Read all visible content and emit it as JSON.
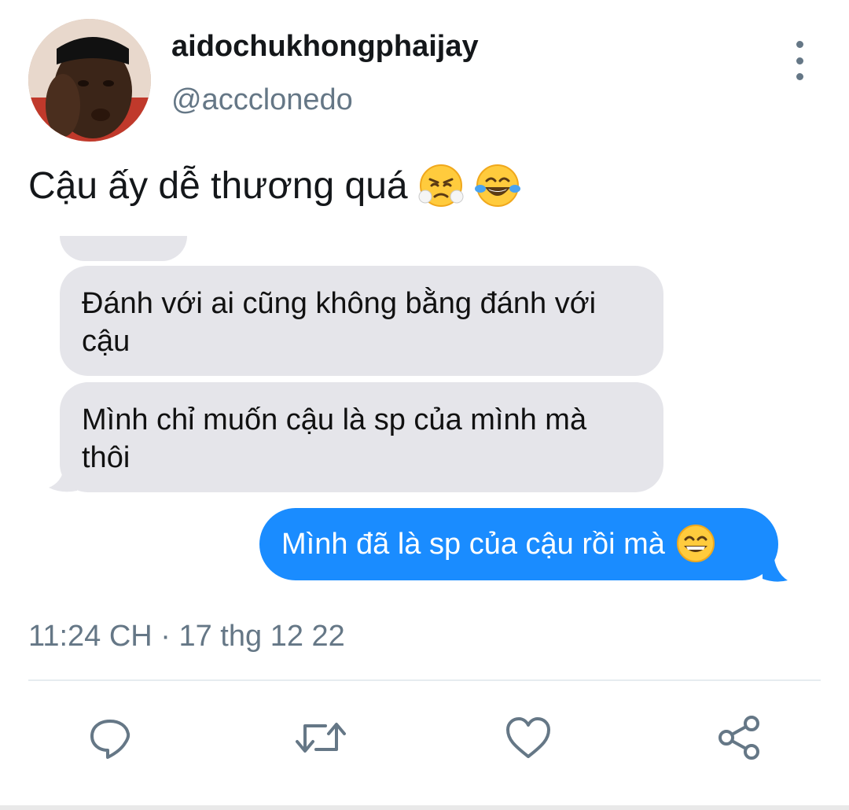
{
  "tweet": {
    "display_name": "aidochukhongphaijay",
    "handle": "@accclonedo",
    "text": "Cậu ấy dễ thương quá",
    "emojis": [
      "face-with-steam-from-nose",
      "face-with-tears-of-joy"
    ],
    "timestamp": "11:24 CH · 17 thg 12 22"
  },
  "chat_image": {
    "incoming": [
      "Đánh với ai cũng không bằng đánh với cậu",
      "Mình chỉ muốn cậu là sp của mình mà thôi"
    ],
    "outgoing": "Mình đã là sp của cậu rồi mà",
    "outgoing_emoji": "grinning-face-with-smiling-eyes",
    "incoming_color": "#e5e5ea",
    "outgoing_color": "#1a8cff"
  },
  "actions": [
    "reply-icon",
    "retweet-icon",
    "like-icon",
    "share-icon"
  ],
  "colors": {
    "secondary_text": "#657786",
    "primary_text": "#14171a"
  }
}
